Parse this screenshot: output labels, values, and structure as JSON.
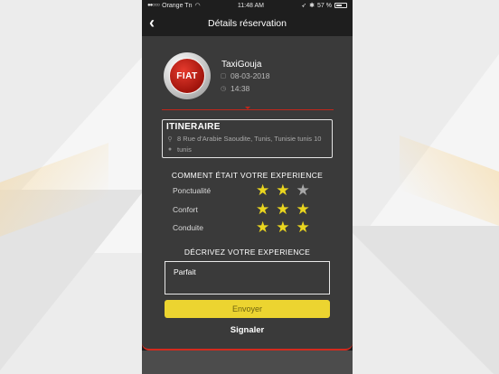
{
  "status_bar": {
    "signal": "●●○○○",
    "carrier": "Orange Tn",
    "time": "11:48 AM",
    "battery": "57 %"
  },
  "nav": {
    "title": "Détails réservation"
  },
  "booking": {
    "logo_text": "FIAT",
    "company": "TaxiGouja",
    "date": "08-03-2018",
    "time": "14:38"
  },
  "itinerary": {
    "title": "ITINERAIRE",
    "from": "8 Rue d'Arabie Saoudite, Tunis, Tunisie tunis 10",
    "to": "tunis"
  },
  "rating": {
    "title": "COMMENT ÉTAIT VOTRE EXPERIENCE",
    "items": [
      {
        "label": "Ponctualité",
        "value": 2,
        "max": 3
      },
      {
        "label": "Confort",
        "value": 3,
        "max": 3
      },
      {
        "label": "Conduite",
        "value": 3,
        "max": 3
      }
    ]
  },
  "feedback": {
    "title": "DÉCRIVEZ VOTRE EXPERIENCE",
    "value": "Parfait"
  },
  "actions": {
    "submit_label": "Envoyer",
    "report_label": "Signaler"
  },
  "colors": {
    "accent": "#ecd430",
    "star_on": "#e9d51f",
    "star_off": "#a8a8a8",
    "divider": "#c0271b",
    "card": "#3a3a3a"
  }
}
